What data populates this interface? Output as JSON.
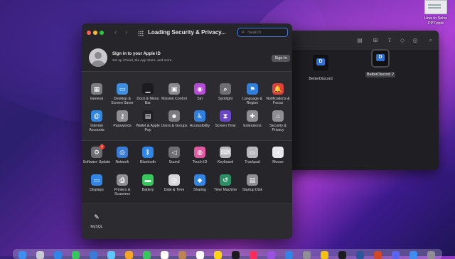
{
  "desktop": {
    "file": {
      "name": "How to Solve PPT.pptx"
    }
  },
  "finder": {
    "toolbar_icons": [
      "sidebar-icon",
      "back-icon",
      "view-icon",
      "group-icon",
      "share-icon",
      "tag-icon",
      "action-icon",
      "more-icon"
    ],
    "items": [
      {
        "label": "BetterDiscord",
        "selected": false
      },
      {
        "label": "BetterDiscord 2",
        "selected": true
      }
    ]
  },
  "prefs": {
    "title": "Loading Security & Privacy...",
    "nav": {
      "back": "‹",
      "forward": "›"
    },
    "search": {
      "placeholder": "Search",
      "value": ""
    },
    "account": {
      "title": "Sign in to your Apple ID",
      "subtitle": "Set up iCloud, the App Store, and more.",
      "button": "Sign In"
    },
    "section1": [
      {
        "label": "General",
        "icon": "general-icon",
        "color": "#7b7b82"
      },
      {
        "label": "Desktop & Screen Saver",
        "icon": "desktop-icon",
        "color": "#3e8ee0"
      },
      {
        "label": "Dock & Menu Bar",
        "icon": "dock-icon",
        "color": "#1c1c1f"
      },
      {
        "label": "Mission Control",
        "icon": "mission-control-icon",
        "color": "#8a8a90"
      },
      {
        "label": "Siri",
        "icon": "siri-icon",
        "color": "#b84ad8"
      },
      {
        "label": "Spotlight",
        "icon": "spotlight-icon",
        "color": "#6d6d73"
      },
      {
        "label": "Language & Region",
        "icon": "language-icon",
        "color": "#2f7fe0"
      },
      {
        "label": "Notifications & Focus",
        "icon": "notifications-icon",
        "color": "#e0403b"
      },
      {
        "label": "Internet Accounts",
        "icon": "internet-accounts-icon",
        "color": "#2f86e6"
      },
      {
        "label": "Passwords",
        "icon": "passwords-icon",
        "color": "#8e8e94"
      },
      {
        "label": "Wallet & Apple Pay",
        "icon": "wallet-icon",
        "color": "#222226"
      },
      {
        "label": "Users & Groups",
        "icon": "users-icon",
        "color": "#7a7a80"
      },
      {
        "label": "Accessibility",
        "icon": "accessibility-icon",
        "color": "#2f7fe0"
      },
      {
        "label": "Screen Time",
        "icon": "screen-time-icon",
        "color": "#6a45c8"
      },
      {
        "label": "Extensions",
        "icon": "extensions-icon",
        "color": "#8e8e94"
      },
      {
        "label": "Security & Privacy",
        "icon": "security-icon",
        "color": "#8e8e94"
      }
    ],
    "section2": [
      {
        "label": "Software Update",
        "icon": "software-update-icon",
        "color": "#6d6d73",
        "badge": "1"
      },
      {
        "label": "Network",
        "icon": "network-icon",
        "color": "#3a7bd5"
      },
      {
        "label": "Bluetooth",
        "icon": "bluetooth-icon",
        "color": "#2f86e6"
      },
      {
        "label": "Sound",
        "icon": "sound-icon",
        "color": "#6d6d73"
      },
      {
        "label": "Touch ID",
        "icon": "touch-id-icon",
        "color": "#e25aa0"
      },
      {
        "label": "Keyboard",
        "icon": "keyboard-icon",
        "color": "#b8b8bd"
      },
      {
        "label": "Trackpad",
        "icon": "trackpad-icon",
        "color": "#b8b8bd"
      },
      {
        "label": "Mouse",
        "icon": "mouse-icon",
        "color": "#e8e8ec"
      },
      {
        "label": "Displays",
        "icon": "displays-icon",
        "color": "#2f86e6"
      },
      {
        "label": "Printers & Scanners",
        "icon": "printers-icon",
        "color": "#8e8e94"
      },
      {
        "label": "Battery",
        "icon": "battery-icon",
        "color": "#35c759"
      },
      {
        "label": "Date & Time",
        "icon": "date-time-icon",
        "color": "#d8d8dc"
      },
      {
        "label": "Sharing",
        "icon": "sharing-icon",
        "color": "#2f86e6"
      },
      {
        "label": "Time Machine",
        "icon": "time-machine-icon",
        "color": "#2a8f62"
      },
      {
        "label": "Startup Disk",
        "icon": "startup-disk-icon",
        "color": "#8e8e94"
      }
    ],
    "section3": [
      {
        "label": "MySQL",
        "icon": "mysql-icon",
        "color": "#2b2a30"
      }
    ]
  },
  "dock": {
    "icons": [
      "finder-icon",
      "launchpad-icon",
      "safari-icon",
      "messages-icon",
      "mail-icon",
      "maps-icon",
      "photos-icon",
      "facetime-icon",
      "calendar-icon",
      "contacts-icon",
      "reminders-icon",
      "notes-icon",
      "tv-icon",
      "music-icon",
      "podcasts-icon",
      "app-store-icon",
      "system-preferences-icon",
      "chrome-icon",
      "terminal-icon",
      "word-icon",
      "powerpoint-icon",
      "discord-icon",
      "finder-window-icon",
      "trash-icon"
    ]
  }
}
